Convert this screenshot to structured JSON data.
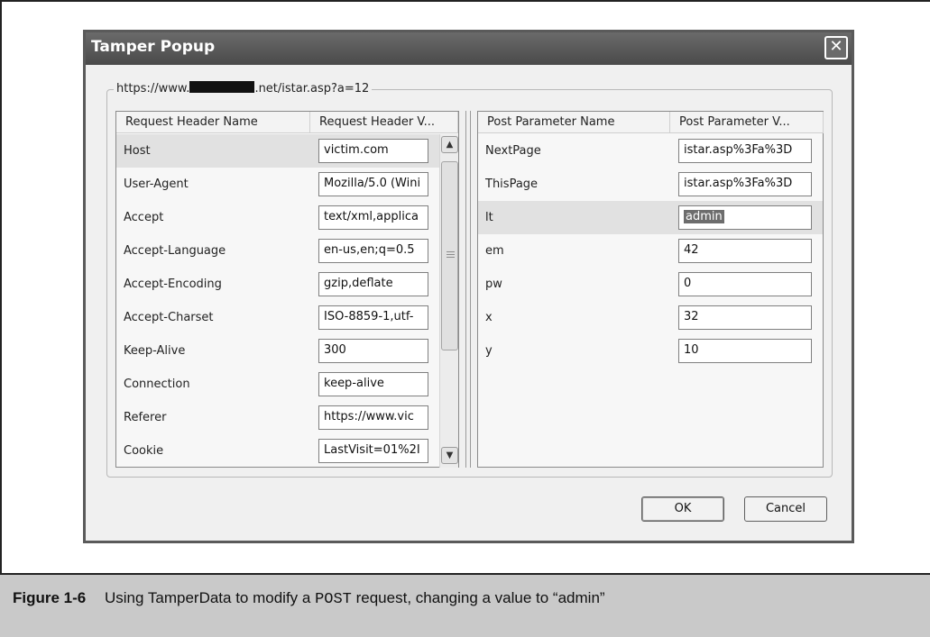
{
  "window": {
    "title": "Tamper Popup",
    "close_glyph": "✕"
  },
  "url": {
    "prefix": "https://www.",
    "suffix": ".net/istar.asp?a=12"
  },
  "headers_panel": {
    "col1": "Request Header Name",
    "col2": "Request Header V...",
    "rows": [
      {
        "name": "Host",
        "value": "victim.com"
      },
      {
        "name": "User-Agent",
        "value": "Mozilla/5.0 (Wini"
      },
      {
        "name": "Accept",
        "value": "text/xml,applica"
      },
      {
        "name": "Accept-Language",
        "value": "en-us,en;q=0.5"
      },
      {
        "name": "Accept-Encoding",
        "value": "gzip,deflate"
      },
      {
        "name": "Accept-Charset",
        "value": "ISO-8859-1,utf-"
      },
      {
        "name": "Keep-Alive",
        "value": "300"
      },
      {
        "name": "Connection",
        "value": "keep-alive"
      },
      {
        "name": "Referer",
        "value": "https://www.vic"
      },
      {
        "name": "Cookie",
        "value": "LastVisit=01%2I"
      }
    ]
  },
  "post_panel": {
    "col1": "Post Parameter Name",
    "col2": "Post Parameter V...",
    "rows": [
      {
        "name": "NextPage",
        "value": "istar.asp%3Fa%3D"
      },
      {
        "name": "ThisPage",
        "value": "istar.asp%3Fa%3D"
      },
      {
        "name": "lt",
        "value": "admin"
      },
      {
        "name": "em",
        "value": "42"
      },
      {
        "name": "pw",
        "value": "0"
      },
      {
        "name": "x",
        "value": "32"
      },
      {
        "name": "y",
        "value": "10"
      }
    ]
  },
  "buttons": {
    "ok": "OK",
    "cancel": "Cancel"
  },
  "caption": {
    "figure": "Figure 1-6",
    "before": "Using TamperData to modify a ",
    "code": "POST",
    "after": " request, changing a value to “admin”"
  }
}
